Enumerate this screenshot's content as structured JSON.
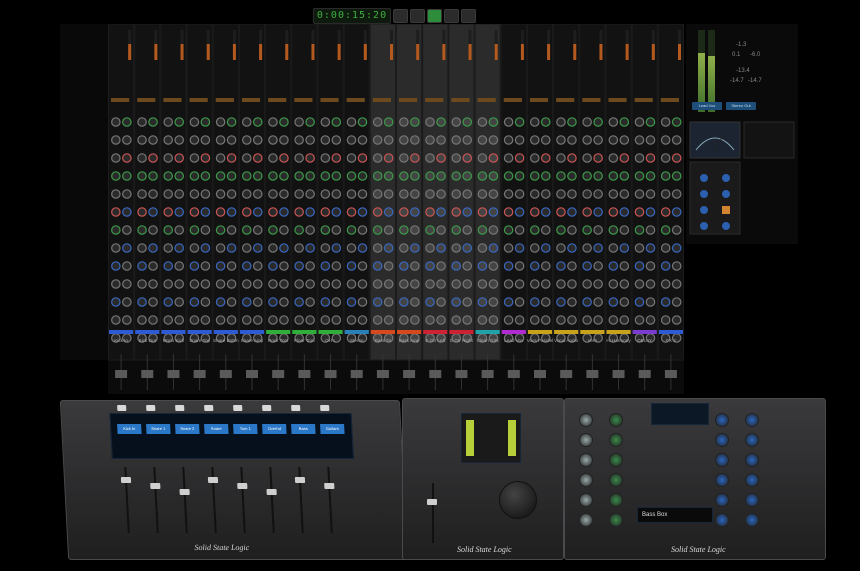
{
  "transport": {
    "timecode": "0:00:15:20"
  },
  "strip_names": [
    "Kick In",
    "Kick Out",
    "Mono Kick",
    "Snare Top",
    "Snare Bottm",
    "Snare Amp",
    "Rock Tom",
    "Floor Tom",
    "OH L",
    "Stereo",
    "Bass DI",
    "Bass Amp",
    "E Gtr Left",
    "E Gtr Right",
    "Clean Gtrs",
    "Lead Vox",
    "Vocs Parallel",
    "Vocal Audio",
    "Verb",
    "Hi Harmony",
    "DELAY",
    "FX 2"
  ],
  "strip_colors": [
    "#2e5bd1",
    "#2e5bd1",
    "#2e5bd1",
    "#2e5bd1",
    "#2e5bd1",
    "#2e5bd1",
    "#2fae3a",
    "#2fae3a",
    "#2fae3a",
    "#2a7fb8",
    "#d44a1e",
    "#d44a1e",
    "#cc2233",
    "#cc2233",
    "#1fa3a8",
    "#b22ad1",
    "#c8a21c",
    "#c8a21c",
    "#c8a21c",
    "#c8a21c",
    "#7a3bd1",
    "#2e5bd1"
  ],
  "meters": {
    "values": [
      "-1.3",
      "0.1",
      "-6.0",
      "-13.4",
      "-14.7",
      "-14.7"
    ]
  },
  "right_panel": {
    "button_a": "Lead Vox",
    "button_b": "Stereo Out",
    "meter_level_left": 0.72,
    "meter_level_right": 0.68
  },
  "hardware": {
    "brand_left": "Solid State Logic",
    "brand_center": "Solid State Logic",
    "brand_right": "Solid State Logic",
    "screen_labels": [
      "Kick In",
      "Snare 1",
      "Snare 2",
      "Snare",
      "Tom 1",
      "Overhd",
      "Bass",
      "Guitars"
    ],
    "screen_text": "Bass Box"
  }
}
